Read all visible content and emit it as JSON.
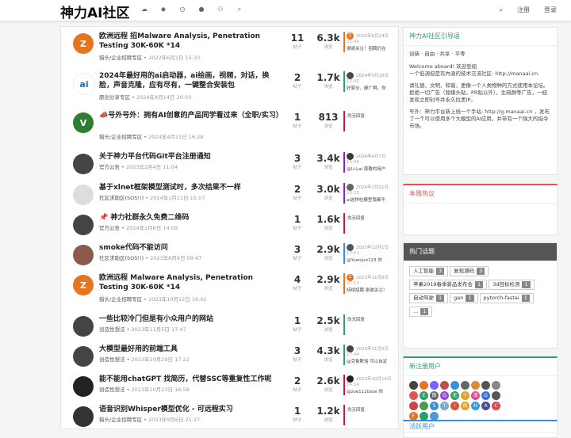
{
  "header": {
    "brand": "神力AI社区",
    "right": {
      "register": "注册",
      "login": "登录"
    },
    "icons": [
      "cloud-icon",
      "diamond-icon",
      "clock-icon",
      "person-icon",
      "group-icon",
      "search-icon"
    ]
  },
  "topics": [
    {
      "title": "欧洲远程 招Malware Analysis, Penetration Testing 30K-60K *14",
      "category": "猎头/企业招聘专区",
      "time": "2022年6月1日 15:33",
      "posts": "11",
      "views": "6.3k",
      "last": {
        "date": "2024年6月24日",
        "time": "22:45",
        "excerpt": "谢谢关注！招聘仍在",
        "avatar_letter": "Z",
        "avatar_color": "#e5751f"
      },
      "avatar": {
        "letter": "Z",
        "color": "#e5751f"
      }
    },
    {
      "title": "2024年最好用的ai启动器，ai绘画，视频，对话，换脸，声音克隆，应有尽有，一键整合安装包",
      "category": "原创分享专区",
      "time": "2024年4月14日 20:03",
      "posts": "2",
      "views": "1.7k",
      "last": {
        "date": "2024年5月20日",
        "time": "12:42",
        "excerpt": "好家伙，硬广啊。你",
        "avatar_letter": "",
        "avatar_color": "#4a4a4a"
      },
      "avatar": {
        "letter": "ai",
        "color": "#ffffff"
      }
    },
    {
      "title": "📣号外号外：拥有AI创意的产品同学看过来（全职/实习）",
      "category": "猎头/企业招聘专区",
      "time": "2024年4月11日 16:28",
      "posts": "1",
      "views": "813",
      "last": {
        "none": "尚无回复"
      },
      "avatar": {
        "letter": "V",
        "color": "#2e7d32"
      }
    },
    {
      "title": "关于神力平台代码Git平台注册通知",
      "category": "官方公告",
      "time": "2023年2月4日 11:04",
      "posts": "3",
      "views": "3.4k",
      "last": {
        "date": "2024年4月7日",
        "time": "15:06",
        "excerpt": "@Li-Lai 尊敬的用户",
        "avatar_letter": "",
        "avatar_color": "#3a3a3a"
      },
      "avatar": {
        "letter": "",
        "color": "#444"
      }
    },
    {
      "title": "基于xlnet框架模型测试时，多次结果不一样",
      "category": "社区求助区(SOS!!)",
      "time": "2024年1月11日 15:07",
      "posts": "2",
      "views": "3.0k",
      "last": {
        "date": "2024年1月11日",
        "time": "16:23",
        "excerpt": "ai这样检模型我都不",
        "avatar_letter": "",
        "avatar_color": "#666"
      },
      "avatar": {
        "letter": "",
        "color": "#ddd"
      }
    },
    {
      "title": "📌 神力社群永久免费二维码",
      "category": "官方公告",
      "time": "2024年1月6日 14:09",
      "posts": "1",
      "views": "1.6k",
      "last": {
        "none": "尚无回复"
      },
      "avatar": {
        "letter": "",
        "color": "#444"
      }
    },
    {
      "title": "smoke代码不能访问",
      "category": "社区求助区(SOS!!)",
      "time": "2023年8月9日 09:47",
      "posts": "3",
      "views": "2.9k",
      "last": {
        "date": "2023年12月1日",
        "time": "17:01",
        "excerpt": "@Yuenjun123 你",
        "avatar_letter": "",
        "avatar_color": "#555"
      },
      "avatar": {
        "letter": "",
        "color": "#8a5a4a"
      }
    },
    {
      "title": "欧洲远程 Malware Analysis, Penetration Testing 30K-60K *14",
      "category": "猎头/企业招聘专区",
      "time": "2023年10月12日 16:02",
      "posts": "4",
      "views": "2.9k",
      "last": {
        "date": "2023年11月8日",
        "time": "17:13",
        "excerpt": "持续招聘 谢谢关注！",
        "avatar_letter": "Z",
        "avatar_color": "#e5751f"
      },
      "avatar": {
        "letter": "Z",
        "color": "#e5751f"
      }
    },
    {
      "title": "一些比较冷门但是有小众用户的网站",
      "category": "创造性想法",
      "time": "2023年11月5日 17:47",
      "posts": "1",
      "views": "2.5k",
      "last": {
        "none": "尚无回复"
      },
      "avatar": {
        "letter": "",
        "color": "#444"
      }
    },
    {
      "title": "大模型最好用的前端工具",
      "category": "创造性想法",
      "time": "2023年10月29日 17:22",
      "posts": "3",
      "views": "4.3k",
      "last": {
        "date": "2023年11月5日",
        "time": "17:44",
        "excerpt": "@克鲁斯洛 可以自定",
        "avatar_letter": "",
        "avatar_color": "#444"
      },
      "avatar": {
        "letter": "",
        "color": "#444"
      }
    },
    {
      "title": "能不能用chatGPT 找简历，代替SSC等重复性工作呢",
      "category": "创造性想法",
      "time": "2023年10月13日 16:58",
      "posts": "2",
      "views": "2.6k",
      "last": {
        "date": "2023年10月16日",
        "time": "14:14",
        "excerpt": "@zoe1110zoe 你",
        "avatar_letter": "",
        "avatar_color": "#222"
      },
      "avatar": {
        "letter": "",
        "color": "#222"
      }
    },
    {
      "title": "语音识别Whisper模型优化 - 可远程实习",
      "category": "猎头/企业招聘专区",
      "time": "2023年9月6日 21:27",
      "posts": "1",
      "views": "1.2k",
      "last": {
        "none": "尚无回复"
      },
      "avatar": {
        "letter": "",
        "color": "#333"
      }
    }
  ],
  "labels": {
    "posts": "帖子",
    "views": "浏览"
  },
  "sidebar": {
    "guide": {
      "title": "神力AI社区引导语",
      "motto": "创新 · 自由 · 共享 · 平等",
      "p1": "Welcome aboard! 欢迎登船",
      "p2": "一个低调但是有內涵的技术交流社区: http://manaai.cn",
      "p3": "请礼貌、文明、和谐、更像一个人类物种的方式使用本论坛。拒绝一切广告（除媒头贴，PR贴以外），生疏群等广告，一经发现立即封号并永久拉黑IP。",
      "p4": "号外：神力平台新上线一个手站: http://g.manaai.cn ，发布了一个可以使用多个大模型的AI应用，并带有一个强大的指令市场。"
    },
    "hot": {
      "title": "本周热议"
    },
    "tags": {
      "title": "热门话题",
      "items": [
        {
          "name": "人工智能",
          "count": "3"
        },
        {
          "name": "复现源码",
          "count": "3"
        },
        {
          "name": "苹果2019春季新品发布会",
          "count": "1"
        },
        {
          "name": "3d目标检测",
          "count": "1"
        },
        {
          "name": "自动驾驶",
          "count": "1"
        },
        {
          "name": "gan",
          "count": "1"
        },
        {
          "name": "pytorch-fastai",
          "count": "1"
        },
        {
          "name": "...",
          "count": "1"
        }
      ]
    },
    "newusers": {
      "title": "新注册用户",
      "avatars": [
        "#444",
        "#e5751f",
        "#7b61ff",
        "#c24d4d",
        "#3a8fd9",
        "#666",
        "#d98c3a",
        "#555",
        "#888",
        "#e05555",
        "#2e9e6a",
        "#666",
        "#9a4ad9",
        "#2e9e6a",
        "#e5a01f",
        "#d94a8a",
        "#3a6fd9",
        "#555",
        "#c44",
        "#4a9a4a",
        "#3a8fd9",
        "#7ac",
        "#d9503a",
        "#e5a01f",
        "#3a9ad9",
        "#4a4a9a",
        "#d94a4a",
        "#e5751f",
        "#2e9e6a",
        "#4a9ad9"
      ],
      "letters": [
        "",
        "",
        "",
        "",
        "",
        "",
        "",
        "",
        "",
        "",
        "E",
        "筒",
        "G",
        "无",
        "十",
        "清",
        "G",
        "",
        "",
        "",
        "S",
        "T",
        "i",
        "凯",
        "H",
        "A",
        "C",
        "F",
        "",
        ""
      ]
    },
    "active": {
      "title": "活跃用户"
    }
  }
}
